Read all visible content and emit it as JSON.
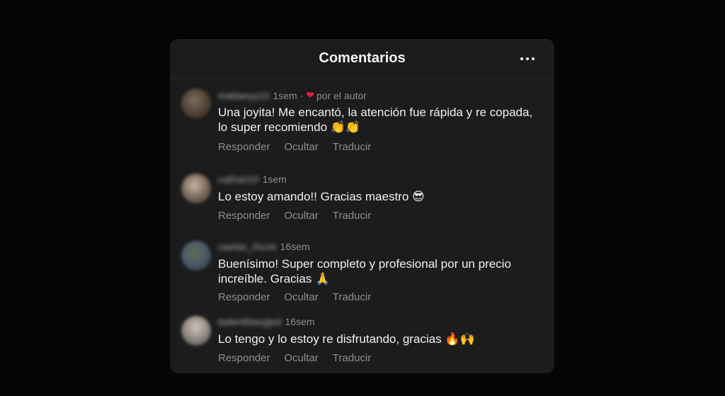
{
  "header": {
    "title": "Comentarios",
    "more_icon": "ellipsis-icon"
  },
  "comments": [
    {
      "username": "mattaeyy10",
      "time": "1sem",
      "separator": "·",
      "liked_by_author": "por el autor",
      "text": "Una joyita! Me encantó, la atención fue rápida y re copada, lo super recomiendo 👏👏",
      "actions": {
        "reply": "Responder",
        "hide": "Ocultar",
        "translate": "Traducir"
      }
    },
    {
      "username": "cathari10",
      "time": "1sem",
      "text": "Lo estoy amando!! Gracias maestro 😎",
      "actions": {
        "reply": "Responder",
        "hide": "Ocultar",
        "translate": "Traducir"
      }
    },
    {
      "username": "caelas_rhcos",
      "time": "16sem",
      "text": "Buenísimo! Super completo y profesional por un precio increíble. Gracias 🙏",
      "actions": {
        "reply": "Responder",
        "hide": "Ocultar",
        "translate": "Traducir"
      }
    },
    {
      "username": "tadenttiseyjpol",
      "time": "16sem",
      "text": "Lo tengo y lo estoy re disfrutando, gracias 🔥🙌",
      "actions": {
        "reply": "Responder",
        "hide": "Ocultar",
        "translate": "Traducir"
      }
    }
  ],
  "colors": {
    "background": "#050505",
    "panel": "#1c1c1c",
    "text": "#f0f0f0",
    "muted": "#8e8e8e",
    "heart": "#ed1c3c"
  }
}
